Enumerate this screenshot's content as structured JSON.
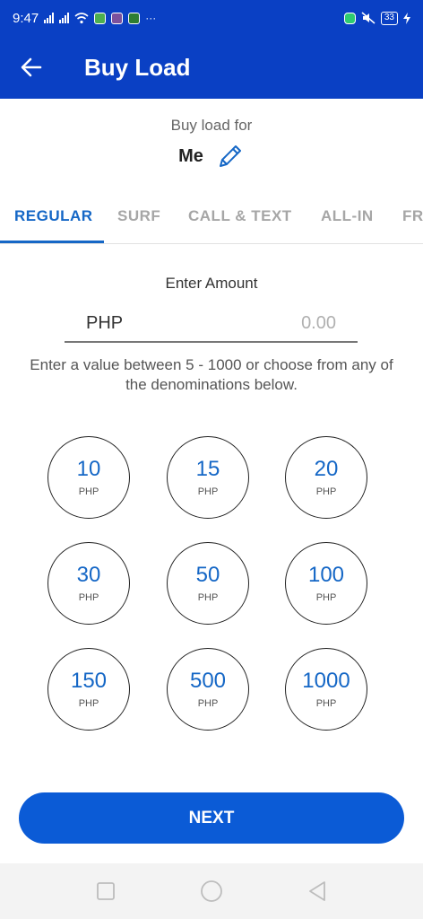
{
  "status_bar": {
    "time": "9:47",
    "battery": "33"
  },
  "app_bar": {
    "title": "Buy Load"
  },
  "recipient": {
    "label": "Buy load for",
    "name": "Me"
  },
  "tabs": [
    {
      "label": "REGULAR",
      "active": true
    },
    {
      "label": "SURF",
      "active": false
    },
    {
      "label": "CALL & TEXT",
      "active": false
    },
    {
      "label": "ALL-IN",
      "active": false
    },
    {
      "label": "FR",
      "active": false
    }
  ],
  "amount": {
    "label": "Enter Amount",
    "currency": "PHP",
    "placeholder": "0.00",
    "hint": "Enter a value between 5 - 1000 or choose from any of the denominations below."
  },
  "denominations": [
    {
      "value": "10",
      "unit": "PHP"
    },
    {
      "value": "15",
      "unit": "PHP"
    },
    {
      "value": "20",
      "unit": "PHP"
    },
    {
      "value": "30",
      "unit": "PHP"
    },
    {
      "value": "50",
      "unit": "PHP"
    },
    {
      "value": "100",
      "unit": "PHP"
    },
    {
      "value": "150",
      "unit": "PHP"
    },
    {
      "value": "500",
      "unit": "PHP"
    },
    {
      "value": "1000",
      "unit": "PHP"
    }
  ],
  "next_button": {
    "label": "NEXT"
  },
  "colors": {
    "primary": "#0a40c4",
    "accent": "#1567c6",
    "button": "#0b5bd6"
  },
  "icons": {
    "back": "arrow-left-icon",
    "edit": "pencil-icon",
    "nav_recents": "square-icon",
    "nav_home": "circle-icon",
    "nav_back": "triangle-icon"
  }
}
